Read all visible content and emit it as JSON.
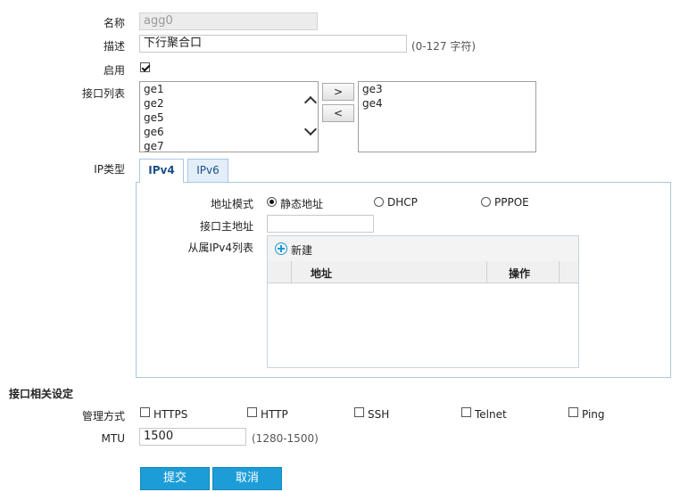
{
  "form": {
    "name_label": "名称",
    "name_value": "agg0",
    "desc_label": "描述",
    "desc_value": "下行聚合口",
    "desc_hint": "(0-127 字符)",
    "enable_label": "启用",
    "enable_checked": true,
    "iface_list_label": "接口列表",
    "available_ifaces": [
      "ge1",
      "ge2",
      "ge5",
      "ge6",
      "ge7"
    ],
    "selected_ifaces": [
      "ge3",
      "ge4"
    ],
    "add_btn": ">",
    "remove_btn": "<",
    "ip_type_label": "IP类型"
  },
  "tabs": [
    {
      "label": "IPv4",
      "active": true
    },
    {
      "label": "IPv6",
      "active": false
    }
  ],
  "ipv4": {
    "addr_mode_label": "地址模式",
    "modes": [
      {
        "label": "静态地址",
        "checked": true
      },
      {
        "label": "DHCP",
        "checked": false
      },
      {
        "label": "PPPOE",
        "checked": false
      }
    ],
    "primary_addr_label": "接口主地址",
    "primary_addr_value": "",
    "secondary_list_label": "从属IPv4列表",
    "new_button": "新建",
    "columns": [
      "地址",
      "操作"
    ]
  },
  "iface_settings": {
    "section_title": "接口相关设定",
    "mgmt_label": "管理方式",
    "mgmt_options": [
      {
        "label": "HTTPS",
        "checked": false
      },
      {
        "label": "HTTP",
        "checked": false
      },
      {
        "label": "SSH",
        "checked": false
      },
      {
        "label": "Telnet",
        "checked": false
      },
      {
        "label": "Ping",
        "checked": false
      }
    ],
    "mtu_label": "MTU",
    "mtu_value": "1500",
    "mtu_hint": "(1280-1500)"
  },
  "actions": {
    "submit": "提交",
    "cancel": "取消"
  },
  "colors": {
    "primary_button": "#1d9dd8",
    "tab_border": "#a9c7e3",
    "tab_text": "#1a4f8a"
  }
}
